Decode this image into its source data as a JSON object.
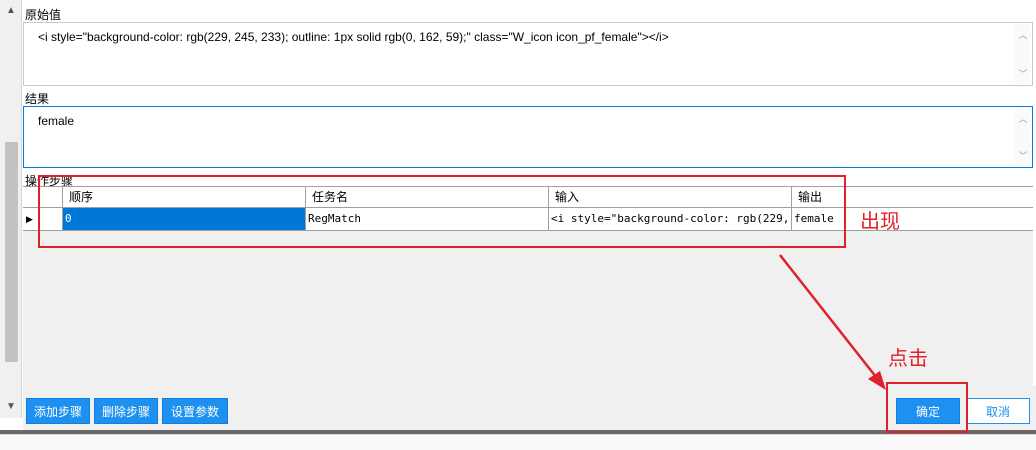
{
  "sections": {
    "original_label": "原始值",
    "result_label": "结果",
    "steps_label": "操作步骤"
  },
  "original_value": "<i style=\"background-color: rgb(229, 245, 233); outline: 1px solid rgb(0, 162, 59);\" class=\"W_icon icon_pf_female\"></i>",
  "result_value": "female",
  "grid": {
    "columns": [
      "顺序",
      "任务名",
      "输入",
      "输出"
    ],
    "rows": [
      {
        "order": "0",
        "task": "RegMatch",
        "input": "<i style=\"background-color: rgb(229,...",
        "output": "female"
      }
    ]
  },
  "buttons": {
    "add_step": "添加步骤",
    "delete_step": "删除步骤",
    "set_params": "设置参数",
    "confirm": "确定",
    "cancel": "取消"
  },
  "annotations": {
    "appear": "出现",
    "click": "点击",
    "color": "#e0202a"
  },
  "colors": {
    "accent": "#1e90f0",
    "selection": "#0078d7"
  }
}
